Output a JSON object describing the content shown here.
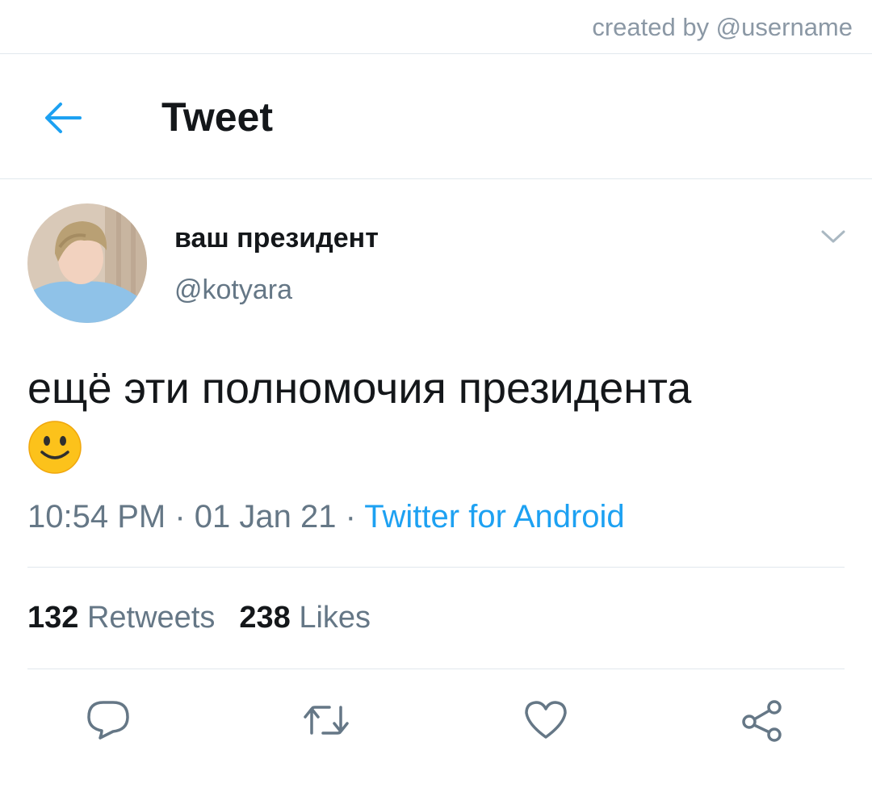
{
  "credit": "created by @username",
  "header": {
    "title": "Tweet"
  },
  "tweet": {
    "display_name": "ваш президент",
    "handle": "@kotyara",
    "text": "ещё эти полномочия президента",
    "time": "10:54 PM",
    "date": "01 Jan 21",
    "separator": " · ",
    "source": "Twitter for Android"
  },
  "stats": {
    "retweets_count": "132",
    "retweets_label": "Retweets",
    "likes_count": "238",
    "likes_label": "Likes"
  },
  "icons": {
    "back": "arrow-left-icon",
    "caret": "chevron-down-icon",
    "emoji": "slightly-smiling-face-emoji",
    "reply": "reply-icon",
    "retweet": "retweet-icon",
    "like": "heart-icon",
    "share": "share-icon"
  },
  "colors": {
    "accent": "#1da1f2",
    "text": "#14171a",
    "secondary": "#657786",
    "divider": "#e1e8ed"
  }
}
